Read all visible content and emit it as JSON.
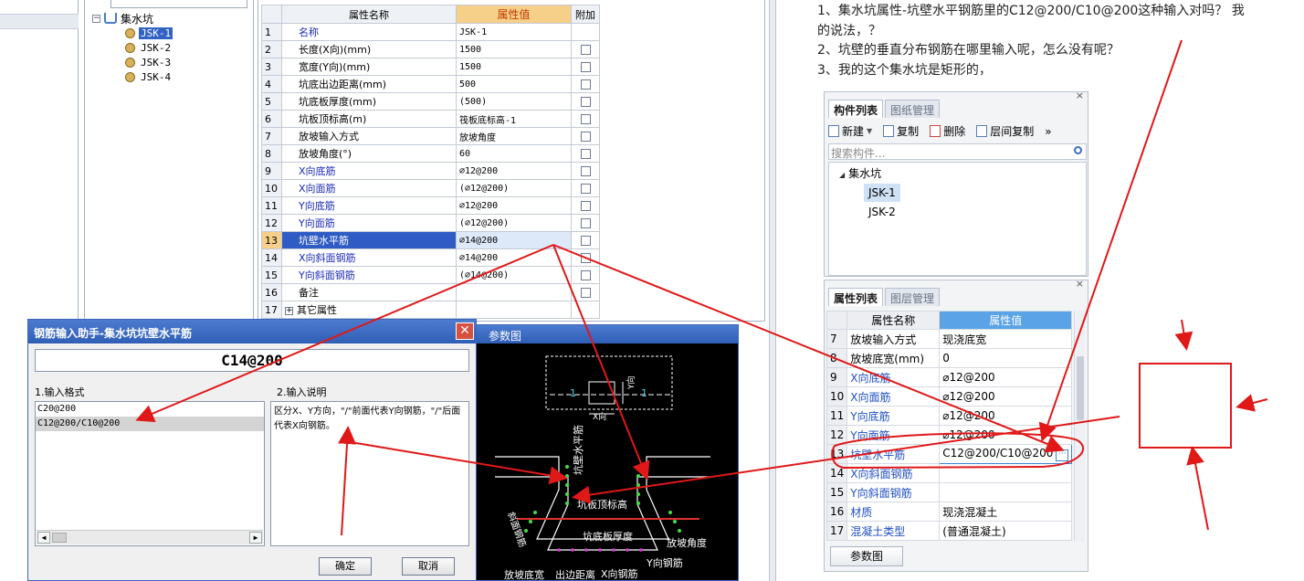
{
  "tree": {
    "root_label": "集水坑",
    "items": [
      {
        "label": "JSK-1",
        "selected": true
      },
      {
        "label": "JSK-2",
        "selected": false
      },
      {
        "label": "JSK-3",
        "selected": false
      },
      {
        "label": "JSK-4",
        "selected": false
      }
    ]
  },
  "props": {
    "headers": {
      "name": "属性名称",
      "value": "属性值",
      "extra": "附加"
    },
    "rows": [
      {
        "num": "1",
        "name": "名称",
        "value": "JSK-1",
        "blue": true,
        "checkbox": false
      },
      {
        "num": "2",
        "name": "长度(X向)(mm)",
        "value": "1500",
        "blue": false,
        "checkbox": true
      },
      {
        "num": "3",
        "name": "宽度(Y向)(mm)",
        "value": "1500",
        "blue": false,
        "checkbox": true
      },
      {
        "num": "4",
        "name": "坑底出边距离(mm)",
        "value": "500",
        "blue": false,
        "checkbox": true
      },
      {
        "num": "5",
        "name": "坑底板厚度(mm)",
        "value": "(500)",
        "blue": false,
        "checkbox": true
      },
      {
        "num": "6",
        "name": "坑板顶标高(m)",
        "value": "筏板底标高-1",
        "blue": false,
        "checkbox": true
      },
      {
        "num": "7",
        "name": "放坡输入方式",
        "value": "放坡角度",
        "blue": false,
        "checkbox": true
      },
      {
        "num": "8",
        "name": "放坡角度(°)",
        "value": "60",
        "blue": false,
        "checkbox": true
      },
      {
        "num": "9",
        "name": "X向底筋",
        "value": "⌀12@200",
        "blue": true,
        "checkbox": true
      },
      {
        "num": "10",
        "name": "X向面筋",
        "value": "(⌀12@200)",
        "blue": true,
        "checkbox": true
      },
      {
        "num": "11",
        "name": "Y向底筋",
        "value": "⌀12@200",
        "blue": true,
        "checkbox": true
      },
      {
        "num": "12",
        "name": "Y向面筋",
        "value": "(⌀12@200)",
        "blue": true,
        "checkbox": true
      },
      {
        "num": "13",
        "name": "坑壁水平筋",
        "value": "⌀14@200",
        "blue": true,
        "checkbox": true,
        "highlight": true
      },
      {
        "num": "14",
        "name": "X向斜面钢筋",
        "value": "⌀14@200",
        "blue": true,
        "checkbox": true
      },
      {
        "num": "15",
        "name": "Y向斜面钢筋",
        "value": "(⌀14@200)",
        "blue": true,
        "checkbox": true
      },
      {
        "num": "16",
        "name": "备注",
        "value": "",
        "blue": false,
        "checkbox": true
      },
      {
        "num": "17",
        "name": "其它属性",
        "value": "",
        "blue": false,
        "checkbox": false,
        "expander": true
      }
    ]
  },
  "dialog": {
    "title": "钢筋输入助手-集水坑坑壁水平筋",
    "close": "✕",
    "expression": "C14@200",
    "section1": "1.输入格式",
    "section2": "2.输入说明",
    "formats": [
      "C20@200",
      "C12@200/C10@200"
    ],
    "description": "区分X、Y方向，\"/\"前面代表Y向钢筋，\"/\"后面代表X向钢筋。",
    "ok": "确定",
    "cancel": "取消"
  },
  "diagram": {
    "title": "参数图",
    "labels": {
      "x_dir": "X向",
      "y_dir": "Y向",
      "one": "1",
      "wall_horizontal": "坑壁水平筋",
      "slab_top_elev": "坑板顶标高",
      "slab_thickness": "坑底板厚度",
      "slope_angle": "放坡角度",
      "y_rebar": "Y向钢筋",
      "x_rebar": "X向钢筋",
      "slope_bottom_width": "放坡底宽",
      "edge_distance": "出边距离",
      "slope_rebar": "斜面钢筋"
    }
  },
  "question": {
    "lines": [
      "1、集水坑属性-坑壁水平钢筋里的C12@200/C10@200这种输入对吗？ 我",
      "的说法，？",
      "2、坑壁的垂直分布钢筋在哪里输入呢，怎么没有呢？",
      "3、我的这个集水坑是矩形的，"
    ]
  },
  "right_panel": {
    "tabs": [
      "构件列表",
      "图纸管理"
    ],
    "toolbar": {
      "new": "新建",
      "copy": "复制",
      "delete": "删除",
      "floor_copy": "层间复制",
      "more": "»"
    },
    "search_placeholder": "搜索构件...",
    "tree_root": "集水坑",
    "tree_items": [
      {
        "label": "JSK-1",
        "selected": true
      },
      {
        "label": "JSK-2",
        "selected": false
      }
    ],
    "close": "×"
  },
  "right_props": {
    "tabs": [
      "属性列表",
      "图层管理"
    ],
    "headers": {
      "name": "属性名称",
      "value": "属性值"
    },
    "rows": [
      {
        "num": "7",
        "name": "放坡输入方式",
        "value": "现浇底宽",
        "blue": false
      },
      {
        "num": "8",
        "name": "放坡底宽(mm)",
        "value": "0",
        "blue": false
      },
      {
        "num": "9",
        "name": "X向底筋",
        "value": "⌀12@200",
        "blue": true
      },
      {
        "num": "10",
        "name": "X向面筋",
        "value": "⌀12@200",
        "blue": true
      },
      {
        "num": "11",
        "name": "Y向底筋",
        "value": "⌀12@200",
        "blue": true
      },
      {
        "num": "12",
        "name": "Y向面筋",
        "value": "⌀12@200",
        "blue": true
      },
      {
        "num": "13",
        "name": "坑壁水平筋",
        "value": "C12@200/C10@200",
        "blue": true,
        "highlight": true
      },
      {
        "num": "14",
        "name": "X向斜面钢筋",
        "value": "",
        "blue": true
      },
      {
        "num": "15",
        "name": "Y向斜面钢筋",
        "value": "",
        "blue": true
      },
      {
        "num": "16",
        "name": "材质",
        "value": "现浇混凝土",
        "blue": true
      },
      {
        "num": "17",
        "name": "混凝土类型",
        "value": "(普通混凝土)",
        "blue": true
      }
    ],
    "param_button": "参数图",
    "close": "×"
  },
  "colors": {
    "annotation": "#e01818",
    "accent": "#2f5bc4",
    "header_highlight": "#f6cf88"
  }
}
